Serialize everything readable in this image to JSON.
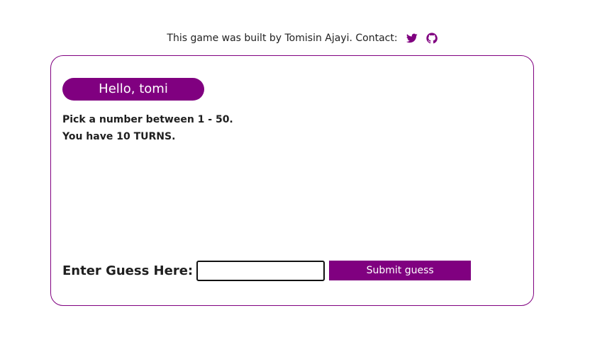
{
  "footer": {
    "credit_text": "This game was built by Tomisin Ajayi. Contact:",
    "icons": [
      "twitter-icon",
      "github-icon"
    ]
  },
  "game": {
    "greeting": "Hello, tomi",
    "instruction_line1": "Pick a number between 1 - 50.",
    "instruction_line2": "You have 10 TURNS.",
    "guess_label": "Enter Guess Here:",
    "guess_value": "",
    "submit_label": "Submit guess"
  },
  "colors": {
    "accent": "#800080",
    "text": "#1f1f1f",
    "background": "#ffffff"
  }
}
